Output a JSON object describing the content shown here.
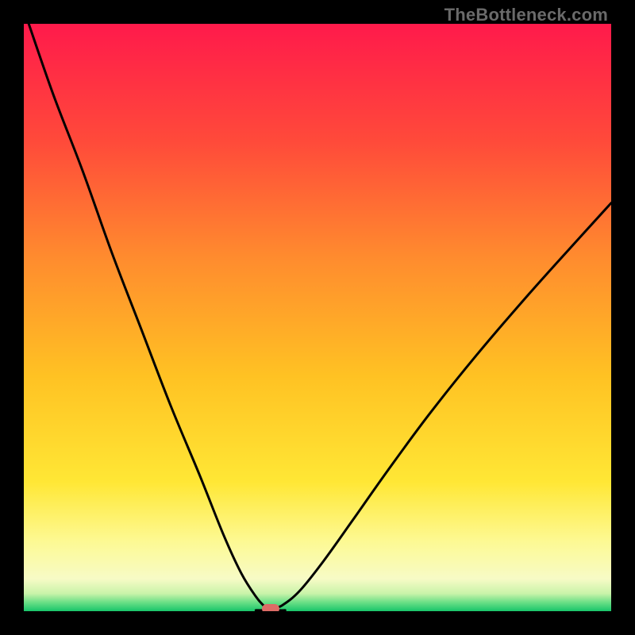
{
  "watermark": "TheBottleneck.com",
  "marker_color": "#dd6b66",
  "curve_color": "#000000",
  "curve_width": 3,
  "gradient_stops": [
    {
      "offset": 0,
      "color": "#ff1a4b"
    },
    {
      "offset": 0.2,
      "color": "#ff4a3a"
    },
    {
      "offset": 0.4,
      "color": "#ff8c2e"
    },
    {
      "offset": 0.6,
      "color": "#ffc223"
    },
    {
      "offset": 0.78,
      "color": "#ffe735"
    },
    {
      "offset": 0.88,
      "color": "#fdf992"
    },
    {
      "offset": 0.945,
      "color": "#f7fbc6"
    },
    {
      "offset": 0.97,
      "color": "#c9f3a9"
    },
    {
      "offset": 0.985,
      "color": "#6adf86"
    },
    {
      "offset": 1.0,
      "color": "#18c56a"
    }
  ],
  "chart_data": {
    "type": "line",
    "title": "",
    "xlabel": "",
    "ylabel": "",
    "xlim": [
      0,
      100
    ],
    "ylim": [
      0,
      100
    ],
    "grid": false,
    "marker": {
      "x": 42,
      "y": 0
    },
    "series": [
      {
        "name": "curve-left",
        "x": [
          0.5,
          5,
          10,
          15,
          20,
          25,
          30,
          34,
          37,
          39.5,
          41,
          42
        ],
        "y": [
          101,
          88,
          75,
          61,
          48,
          35,
          23,
          13,
          6.5,
          2.5,
          0.8,
          0.2
        ]
      },
      {
        "name": "floor",
        "x": [
          39.5,
          42,
          44.5
        ],
        "y": [
          0.15,
          0.12,
          0.15
        ]
      },
      {
        "name": "curve-right",
        "x": [
          42,
          44,
          47,
          51,
          56,
          62,
          69,
          77,
          86,
          95,
          100
        ],
        "y": [
          0.2,
          1.0,
          3.5,
          8.5,
          15.5,
          24,
          33.5,
          43.5,
          54,
          64,
          69.5
        ]
      }
    ]
  }
}
